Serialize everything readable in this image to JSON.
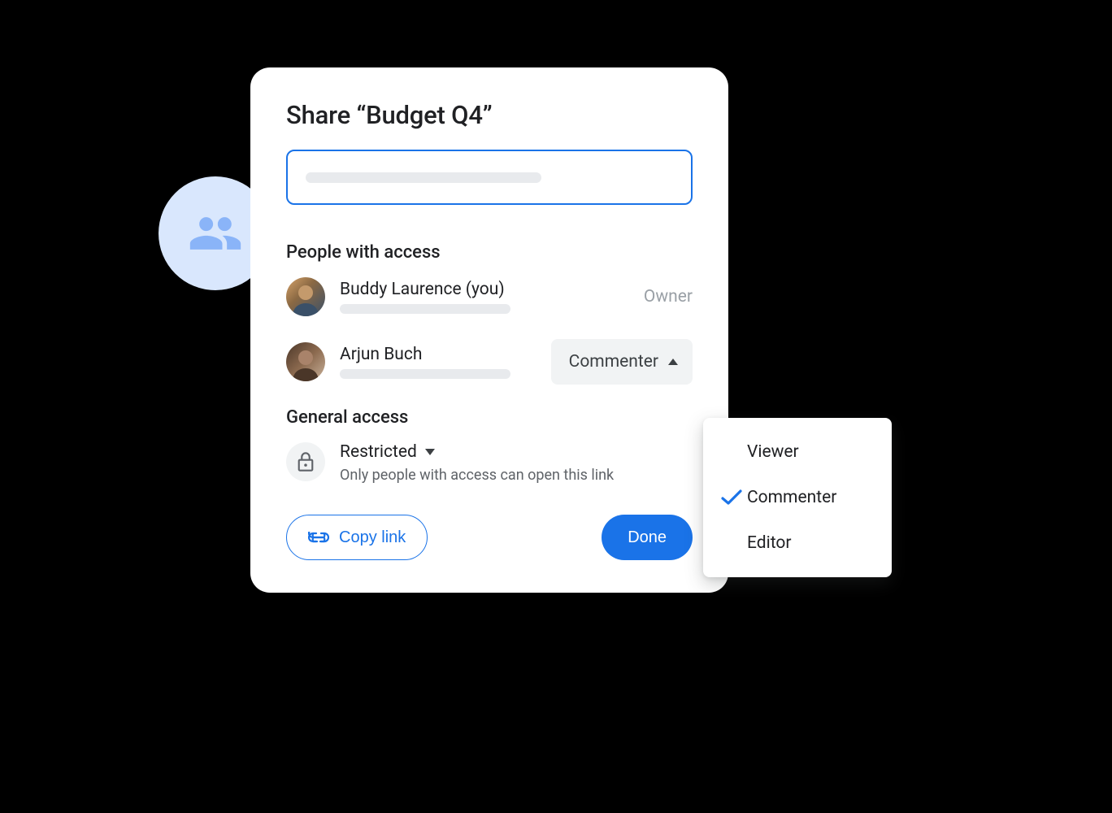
{
  "dialog": {
    "title": "Share “Budget Q4”",
    "people_heading": "People with access",
    "people": [
      {
        "name": "Buddy Laurence (you)",
        "role": "Owner"
      },
      {
        "name": "Arjun Buch",
        "role": "Commenter"
      }
    ],
    "general_access": {
      "heading": "General access",
      "mode": "Restricted",
      "description": "Only people with access can open this link"
    },
    "footer": {
      "copy_link": "Copy link",
      "done": "Done"
    }
  },
  "role_menu": {
    "selected": "Commenter",
    "options": [
      "Viewer",
      "Commenter",
      "Editor"
    ]
  }
}
